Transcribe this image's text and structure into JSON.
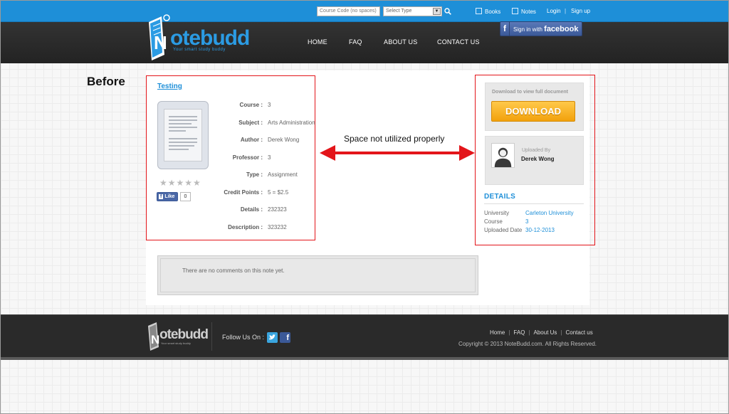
{
  "topbar": {
    "search_placeholder": "Course Code (no spaces)",
    "type_select": "Select Type",
    "links": {
      "books": "Books",
      "notes": "Notes",
      "login": "Login",
      "signup": "Sign up"
    },
    "separator": "|"
  },
  "header": {
    "logo_text": "otebudd",
    "logo_initial": "N",
    "logo_tagline": "Your smart study buddy",
    "nav": {
      "home": "HOME",
      "faq": "FAQ",
      "about": "ABOUT US",
      "contact": "CONTACT US"
    },
    "fb_signin_prefix": "Sign in with",
    "fb_signin_brand": "facebook"
  },
  "annotation": {
    "before_label": "Before",
    "note": "Space not utilized properly"
  },
  "note": {
    "title": "Testing",
    "rating_stars": "★★★★★",
    "like_label": "Like",
    "like_count": "0",
    "fields": [
      {
        "label": "Course :",
        "value": "3"
      },
      {
        "label": "Subject :",
        "value": "Arts Administration"
      },
      {
        "label": "Author :",
        "value": "Derek Wong"
      },
      {
        "label": "Professor :",
        "value": "3"
      },
      {
        "label": "Type :",
        "value": "Assignment"
      },
      {
        "label": "Credit Points :",
        "value": "5 = $2.5"
      },
      {
        "label": "Details :",
        "value": "232323"
      },
      {
        "label": "Description :",
        "value": "323232"
      }
    ]
  },
  "sidebar": {
    "download_hint": "Download to view full document",
    "download_button": "DOWNLOAD",
    "uploaded_by_label": "Uploaded By",
    "uploader_name": "Derek Wong",
    "details_heading": "DETAILS",
    "details": [
      {
        "label": "University",
        "value": "Carleton University"
      },
      {
        "label": "Course",
        "value": "3"
      },
      {
        "label": "Uploaded Date",
        "value": "30-12-2013"
      }
    ]
  },
  "comments": {
    "empty_text": "There are no comments on this note yet."
  },
  "footer": {
    "logo_text": "otebudd",
    "logo_initial": "N",
    "logo_tagline": "Your smart study buddy",
    "follow_label": "Follow Us On :",
    "links": {
      "home": "Home",
      "faq": "FAQ",
      "about": "About Us",
      "contact": "Contact us"
    },
    "copyright": "Copyright © 2013 NoteBudd.com. All Rights Reserved."
  },
  "colors": {
    "accent": "#1e8fd8",
    "annotation_red": "#e3151a",
    "download_orange": "#f2a10c",
    "facebook_blue": "#3b5998"
  }
}
